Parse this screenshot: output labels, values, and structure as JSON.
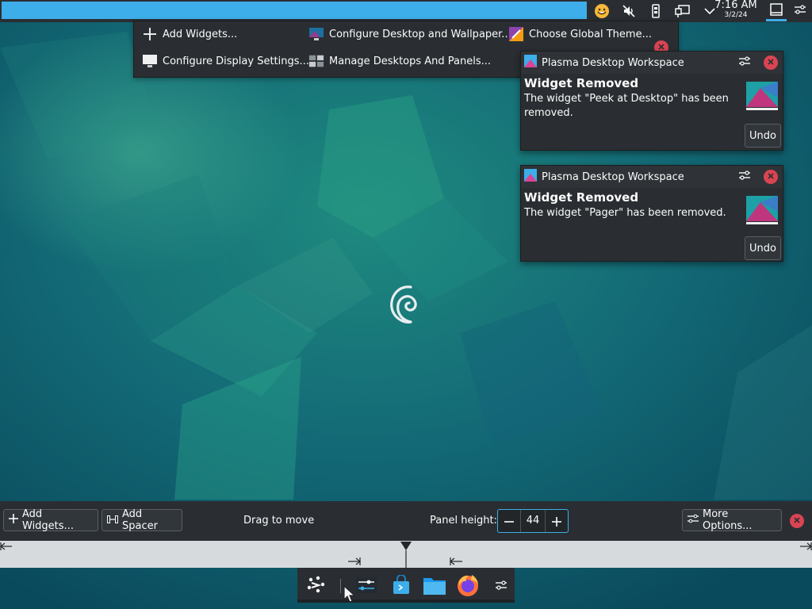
{
  "top_panel": {
    "clock": {
      "time": "7:16 AM",
      "date": "3/2/24"
    },
    "tray_icons": [
      "emoji-icon",
      "volume-muted-icon",
      "usb-device-icon",
      "network-icon",
      "chevron-down-icon"
    ]
  },
  "toolbox": {
    "items": [
      {
        "label": "Add Widgets...",
        "icon": "plus-icon"
      },
      {
        "label": "Configure Desktop and Wallpaper...",
        "icon": "desktop-wallpaper-icon"
      },
      {
        "label": "Choose Global Theme...",
        "icon": "color-theme-icon"
      },
      {
        "label": "Configure Display Settings...",
        "icon": "monitor-icon"
      },
      {
        "label": "Manage Desktops And Panels...",
        "icon": "desktops-panels-icon"
      }
    ]
  },
  "notifications": [
    {
      "app_name": "Plasma Desktop Workspace",
      "title": "Widget Removed",
      "body": "The widget \"Peek at Desktop\" has been removed.",
      "action": "Undo"
    },
    {
      "app_name": "Plasma Desktop Workspace",
      "title": "Widget Removed",
      "body": "The widget \"Pager\" has been removed.",
      "action": "Undo"
    }
  ],
  "panel_editor": {
    "add_widgets_label": "Add Widgets...",
    "add_spacer_label": "Add Spacer",
    "drag_hint": "Drag to move",
    "panel_height_label": "Panel height:",
    "panel_height_value": "44",
    "more_options_label": "More Options..."
  },
  "bottom_panel": {
    "icons": [
      "application-launcher-icon",
      "system-settings-icon",
      "discover-store-icon",
      "file-manager-icon",
      "firefox-icon",
      "panel-config-icon"
    ]
  },
  "colors": {
    "accent": "#3daee9",
    "panel_bg": "#2a2e32",
    "close_red": "#da4453",
    "ruler_bg": "#d7dadd"
  }
}
